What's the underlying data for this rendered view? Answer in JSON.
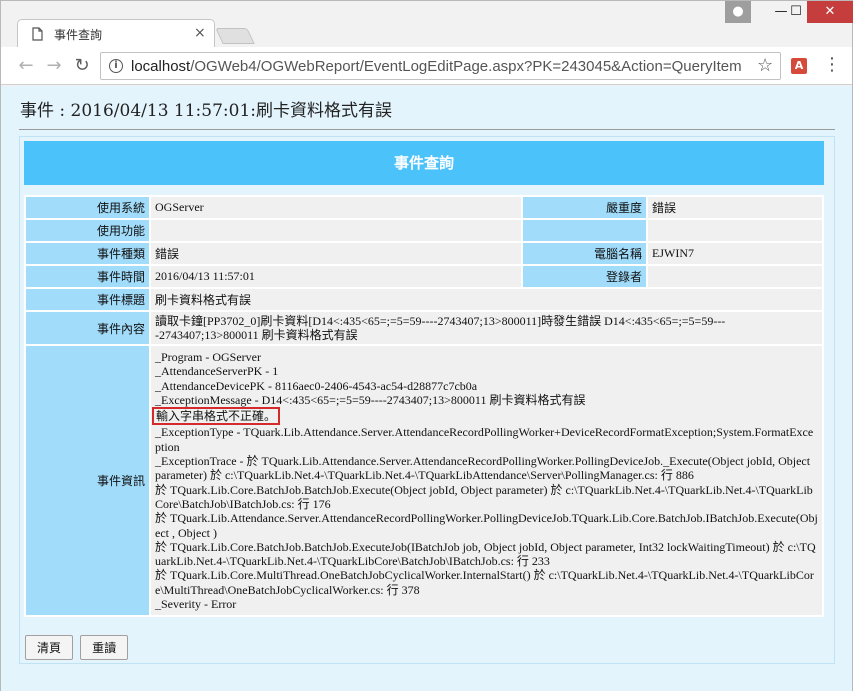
{
  "browser": {
    "tab_title": "事件查詢",
    "tab_close": "×",
    "url_host": "localhost",
    "url_path": "/OGWeb4/OGWebReport/EventLogEditPage.aspx?PK=243045&Action=QueryItem"
  },
  "page": {
    "title": "事件 : 2016/04/13 11:57:01:刷卡資料格式有誤",
    "panel_title": "事件查詢",
    "fields": {
      "system_label": "使用系統",
      "system_value": "OGServer",
      "severity_label": "嚴重度",
      "severity_value": "錯誤",
      "function_label": "使用功能",
      "function_value": "",
      "type_label": "事件種類",
      "type_value": "錯誤",
      "computer_label": "電腦名稱",
      "computer_value": "EJWIN7",
      "time_label": "事件時間",
      "time_value": "2016/04/13 11:57:01",
      "login_label": "登錄者",
      "login_value": "",
      "subject_label": "事件標題",
      "subject_value": "刷卡資料格式有誤",
      "content_label": "事件內容",
      "content_value": "讀取卡鐘[PP3702_0]刷卡資料[D14<:435<65=;=5=59----2743407;13>800011]時發生錯誤 D14<:435<65=;=5=59----2743407;13>800011 刷卡資料格式有誤",
      "detail_label": "事件資訊",
      "detail_lines": [
        "_Program - OGServer",
        "_AttendanceServerPK - 1",
        "_AttendanceDevicePK - 8116aec0-2406-4543-ac54-d28877c7cb0a",
        "_ExceptionMessage - D14<:435<65=;=5=59----2743407;13>800011 刷卡資料格式有誤"
      ],
      "detail_highlight": "輸入字串格式不正確。",
      "detail_lines_after": [
        "_ExceptionType - TQuark.Lib.Attendance.Server.AttendanceRecordPollingWorker+DeviceRecordFormatException;System.FormatException",
        "_ExceptionTrace - 於 TQuark.Lib.Attendance.Server.AttendanceRecordPollingWorker.PollingDeviceJob._Execute(Object jobId, Object parameter) 於 c:\\TQuarkLib.Net.4-\\TQuarkLib.Net.4-\\TQuarkLibAttendance\\Server\\PollingManager.cs: 行 886",
        "於 TQuark.Lib.Core.BatchJob.BatchJob.Execute(Object jobId, Object parameter) 於 c:\\TQuarkLib.Net.4-\\TQuarkLib.Net.4-\\TQuarkLibCore\\BatchJob\\IBatchJob.cs: 行 176",
        "於 TQuark.Lib.Attendance.Server.AttendanceRecordPollingWorker.PollingDeviceJob.TQuark.Lib.Core.BatchJob.IBatchJob.Execute(Object , Object )",
        "於 TQuark.Lib.Core.BatchJob.BatchJob.ExecuteJob(IBatchJob job, Object jobId, Object parameter, Int32 lockWaitingTimeout) 於 c:\\TQuarkLib.Net.4-\\TQuarkLib.Net.4-\\TQuarkLibCore\\BatchJob\\IBatchJob.cs: 行 233",
        "於 TQuark.Lib.Core.MultiThread.OneBatchJobCyclicalWorker.InternalStart() 於 c:\\TQuarkLib.Net.4-\\TQuarkLib.Net.4-\\TQuarkLibCore\\MultiThread\\OneBatchJobCyclicalWorker.cs: 行 378",
        "_Severity - Error"
      ]
    },
    "buttons": {
      "clear": "清頁",
      "reload": "重讀"
    }
  },
  "colors": {
    "header_bar": "#4cc2fb",
    "label_cell": "#a1dcfb",
    "highlight_border": "#d42a2a"
  }
}
